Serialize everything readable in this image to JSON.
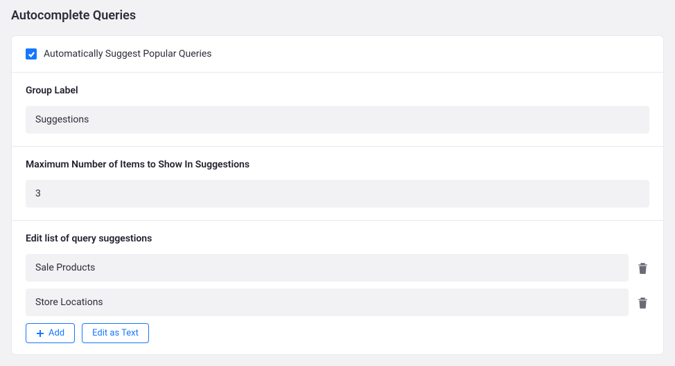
{
  "page": {
    "title": "Autocomplete Queries"
  },
  "autoSuggest": {
    "label": "Automatically Suggest Popular Queries",
    "checked": true
  },
  "groupLabel": {
    "label": "Group Label",
    "value": "Suggestions"
  },
  "maxItems": {
    "label": "Maximum Number of Items to Show In Suggestions",
    "value": "3"
  },
  "querySuggestions": {
    "label": "Edit list of query suggestions",
    "items": [
      "Sale Products",
      "Store Locations"
    ]
  },
  "buttons": {
    "add": "Add",
    "editAsText": "Edit as Text"
  }
}
